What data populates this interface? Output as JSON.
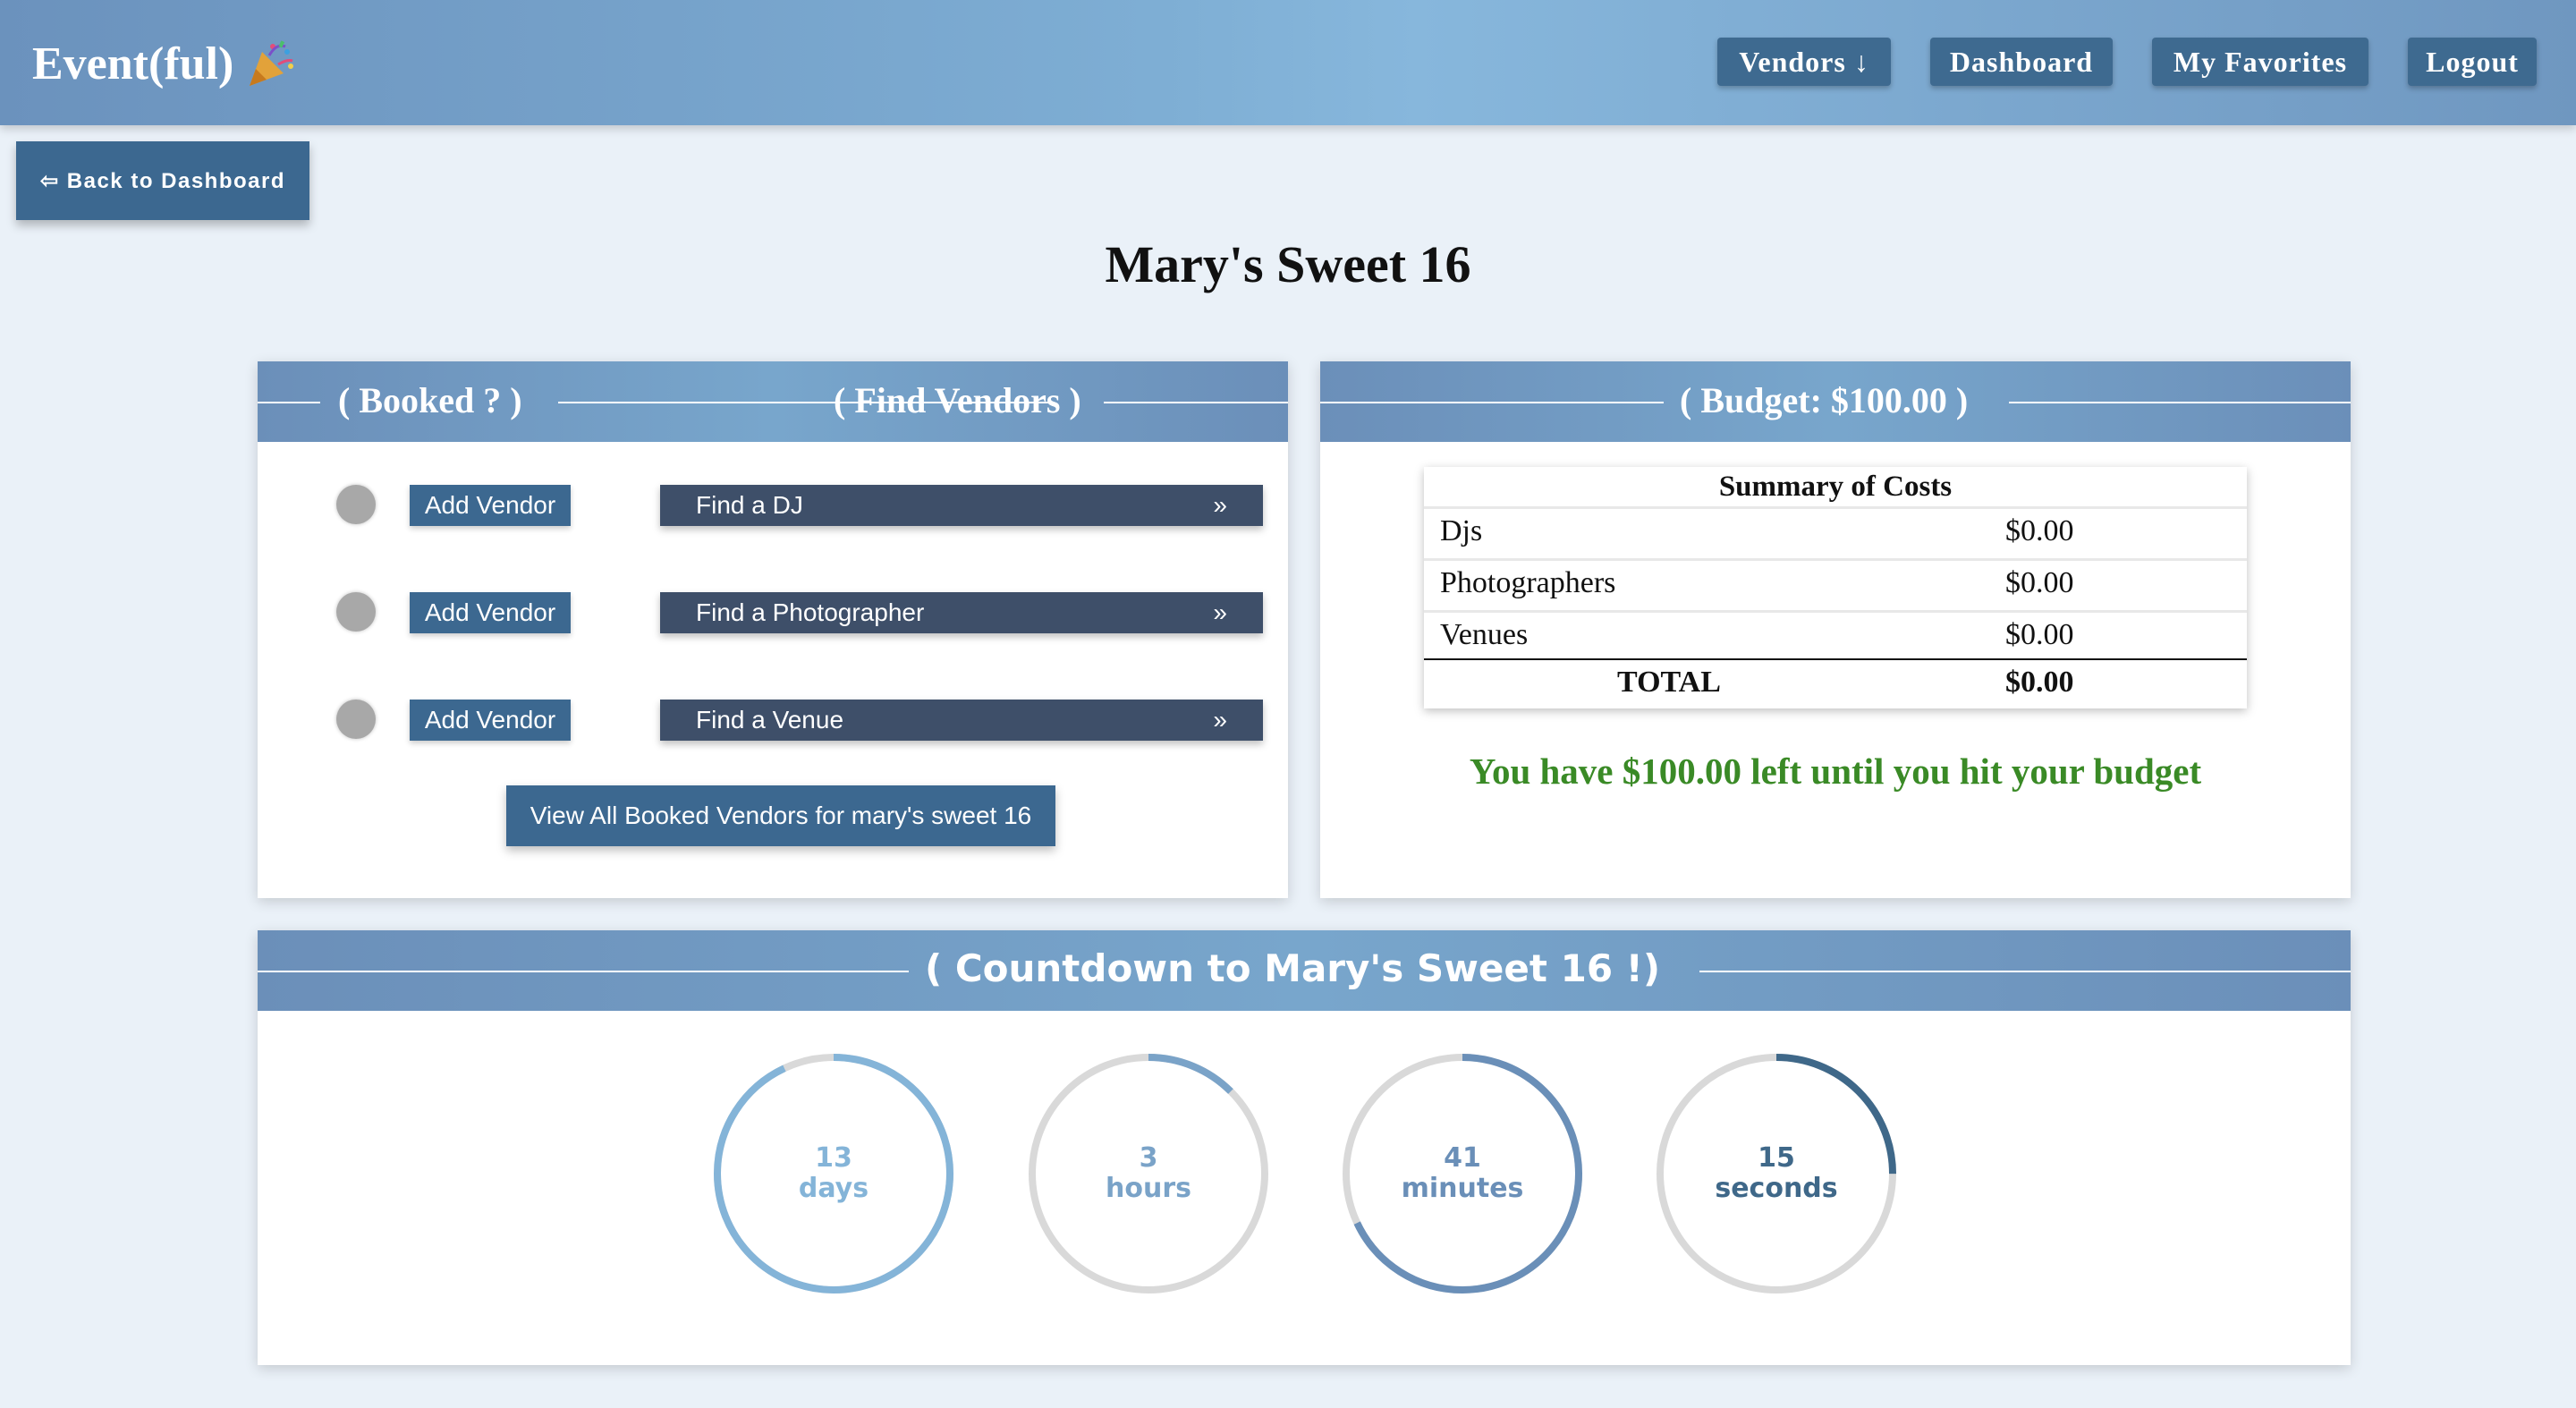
{
  "nav": {
    "brand": "Event(ful)",
    "brand_icon": "party-popper-icon",
    "items": [
      "Vendors ↓",
      "Dashboard",
      "My Favorites",
      "Logout"
    ]
  },
  "back_button": "⇦ Back to Dashboard",
  "page_title": "Mary's Sweet 16",
  "vendors_card": {
    "booked_heading": "( Booked ? )",
    "find_heading": "( Find Vendors )",
    "rows": [
      {
        "add_label": "Add Vendor",
        "find_label": "Find a DJ",
        "arrow": "»"
      },
      {
        "add_label": "Add Vendor",
        "find_label": "Find a Photographer",
        "arrow": "»"
      },
      {
        "add_label": "Add Vendor",
        "find_label": "Find a Venue",
        "arrow": "»"
      }
    ],
    "view_all_label": "View All Booked Vendors for mary's sweet 16"
  },
  "budget_card": {
    "heading": "( Budget: $100.00 )",
    "table_caption": "Summary of Costs",
    "rows": [
      {
        "name": "Djs",
        "value": "$0.00"
      },
      {
        "name": "Photographers",
        "value": "$0.00"
      },
      {
        "name": "Venues",
        "value": "$0.00"
      }
    ],
    "total_label": "TOTAL",
    "total_value": "$0.00",
    "message": "You have $100.00 left until you hit your budget"
  },
  "countdown": {
    "heading": "( Countdown to Mary's Sweet 16 !)",
    "units": [
      {
        "value": "13",
        "label": "days",
        "progress": 0.93,
        "color": "#84b4d8"
      },
      {
        "value": "3",
        "label": "hours",
        "progress": 0.125,
        "color": "#7aa3c8"
      },
      {
        "value": "41",
        "label": "minutes",
        "progress": 0.68,
        "color": "#6a8fb8"
      },
      {
        "value": "15",
        "label": "seconds",
        "progress": 0.25,
        "color": "#3f6889"
      }
    ]
  }
}
